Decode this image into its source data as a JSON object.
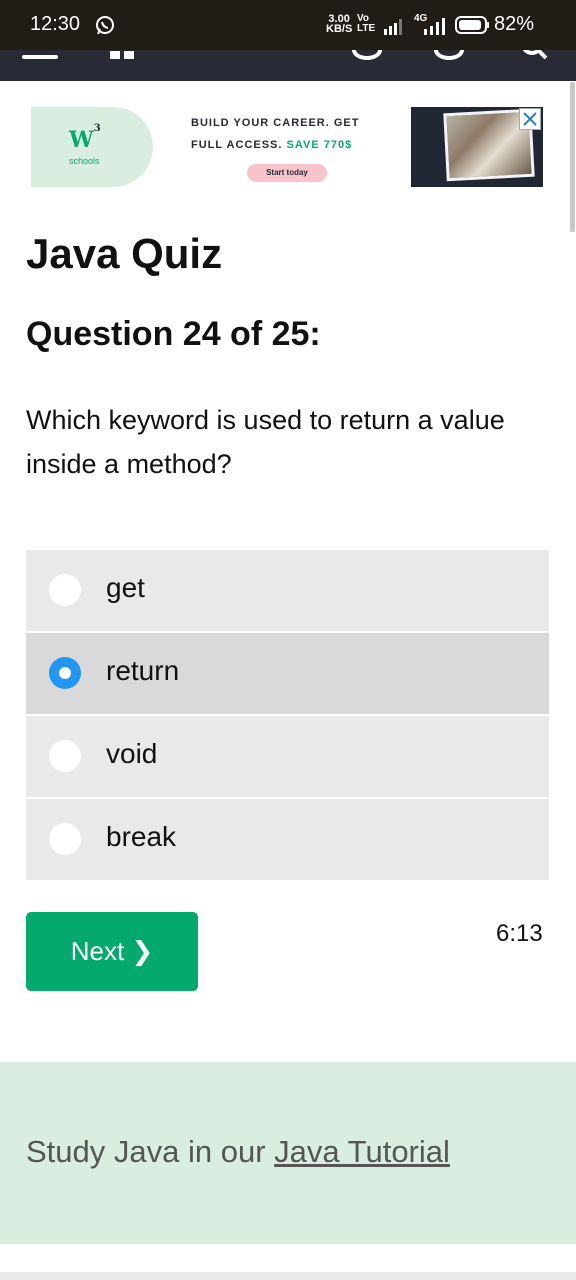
{
  "status_bar": {
    "time": "12:30",
    "speed_value": "3.00",
    "speed_unit": "KB/S",
    "volte_top": "Vo",
    "volte_bottom": "LTE",
    "network": "4G",
    "battery": "82%"
  },
  "ad": {
    "logo": "W",
    "logo_sup": "3",
    "logo_sub": "schools",
    "line1": "BUILD YOUR CAREER. GET",
    "line2_prefix": "FULL ACCESS.",
    "line2_save": "SAVE 770$",
    "cta": "Start today"
  },
  "page": {
    "title": "Java Quiz",
    "question_number": "Question 24 of 25:",
    "question_text": "Which keyword is used to return a value inside a method?"
  },
  "options": [
    {
      "label": "get",
      "selected": false
    },
    {
      "label": "return",
      "selected": true
    },
    {
      "label": "void",
      "selected": false
    },
    {
      "label": "break",
      "selected": false
    }
  ],
  "next_button": "Next ❯",
  "timer": "6:13",
  "promo": {
    "prefix": "Study Java in our ",
    "link": "Java Tutorial"
  },
  "colors": {
    "accent_green": "#04aa6d",
    "radio_selected": "#2196f3",
    "option_bg": "#e7e9eb",
    "promo_bg": "#d9eee1"
  }
}
